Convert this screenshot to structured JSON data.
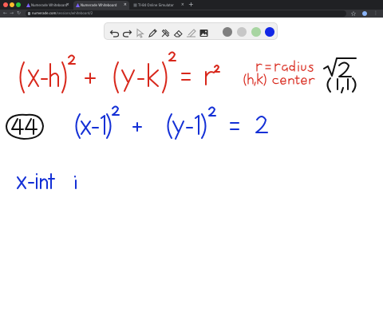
{
  "browser": {
    "tabs": [
      {
        "title": "Numerade Whiteboard",
        "active": false
      },
      {
        "title": "Numerade Whiteboard",
        "active": true
      },
      {
        "title": "TI-84 Online Simulator",
        "active": false
      }
    ],
    "new_tab_label": "+",
    "url_host": "numerade.com",
    "url_path": "/sessions/whiteboard/2"
  },
  "toolbar": {
    "tools": [
      "undo-icon",
      "redo-icon",
      "pointer-icon",
      "pen-icon",
      "tools-icon",
      "eraser-icon",
      "highlighter-icon",
      "image-icon"
    ],
    "colors": [
      "#7f7f7f",
      "#c7c7c7",
      "#a8d5a2",
      "#1227e6"
    ],
    "selected_color": "#1227e6"
  },
  "whiteboard": {
    "ink_red": "#d8271b",
    "ink_blue": "#1430d6",
    "ink_black": "#111111",
    "line1": {
      "term1": "(x-h)",
      "exp1": "2",
      "plus": "+",
      "term2": "(y-k)",
      "exp2": "2",
      "equals": "=",
      "rhs": "r²"
    },
    "notes": {
      "radius": "r = radius",
      "center": "(h,k) center"
    },
    "answers": {
      "radius_value": "√2",
      "center_value": "(1,1)"
    },
    "problem_number": "44",
    "line2": {
      "term1": "(x-1)",
      "exp1": "2",
      "plus": "+",
      "term2": "(y-1)",
      "exp2": "2",
      "equals": "=",
      "rhs": "2"
    },
    "line3": {
      "label": "x-int",
      "cursor": "i"
    }
  }
}
